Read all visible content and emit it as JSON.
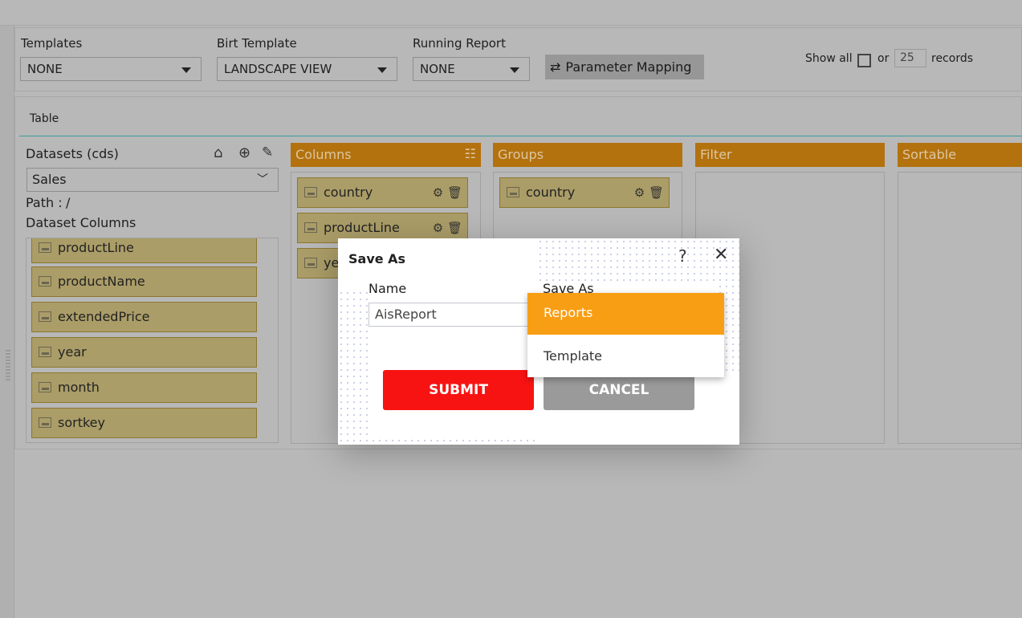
{
  "toolbar": {
    "templates": {
      "label": "Templates",
      "value": "NONE"
    },
    "birt_template": {
      "label": "Birt Template",
      "value": "LANDSCAPE VIEW"
    },
    "running_report": {
      "label": "Running Report",
      "value": "NONE"
    },
    "parameter_mapping": "Parameter Mapping",
    "show_all": "Show all",
    "or": "or",
    "records_value": "25",
    "records": "records"
  },
  "tab": "Table",
  "datasets": {
    "title": "Datasets (cds)",
    "selected": "Sales",
    "path_label": "Path :",
    "path": "/",
    "columns_label": "Dataset Columns",
    "columns": [
      "productLine",
      "productName",
      "extendedPrice",
      "year",
      "month",
      "sortkey"
    ]
  },
  "panels": {
    "columns": {
      "title": "Columns",
      "items": [
        "country",
        "productLine",
        "year"
      ]
    },
    "groups": {
      "title": "Groups",
      "items": [
        "country"
      ]
    },
    "filter": {
      "title": "Filter"
    },
    "sortable": {
      "title": "Sortable"
    }
  },
  "dialog": {
    "title": "Save As",
    "help": "?",
    "name_label": "Name",
    "name_value": "AisReport",
    "saveas_label": "Save As",
    "options": [
      "Reports",
      "Template"
    ],
    "selected": "Reports",
    "submit": "SUBMIT",
    "cancel": "CANCEL"
  },
  "colors": {
    "header": "#b3720e",
    "item": "#ab9d68",
    "submit": "#f81313",
    "cancel": "#9a9a9a",
    "selected_option": "#f89e14"
  }
}
